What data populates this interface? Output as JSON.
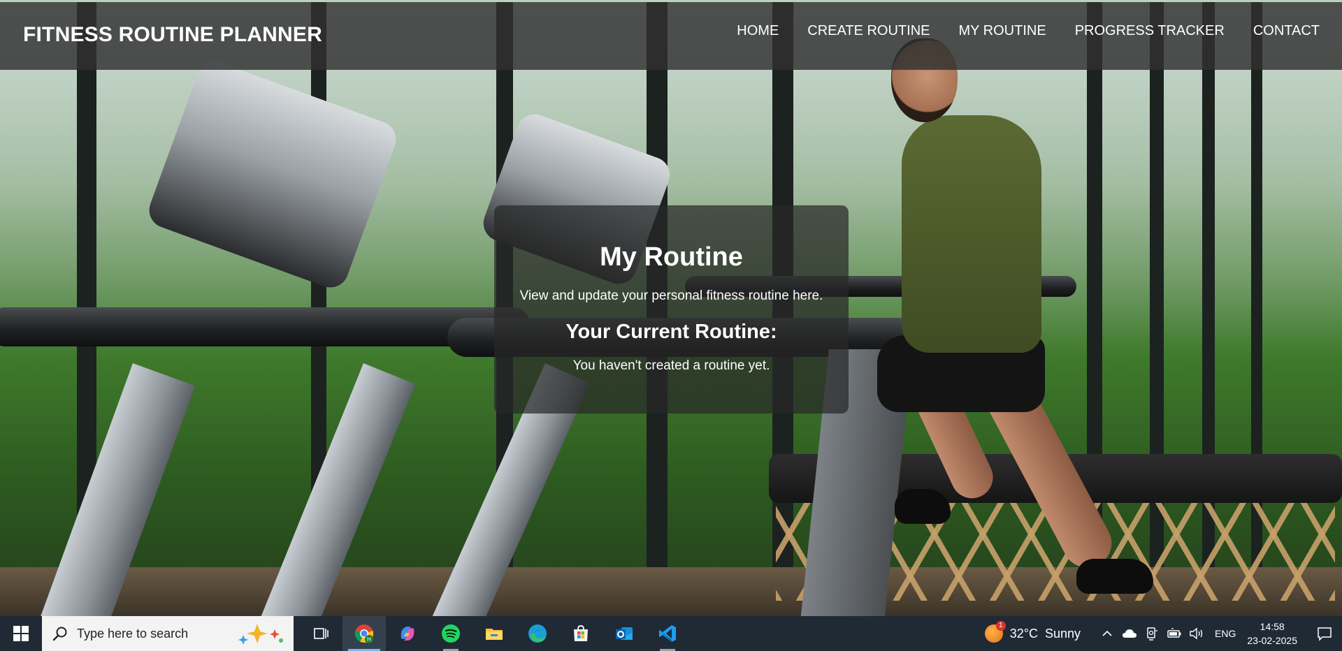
{
  "app": {
    "brand": "FITNESS ROUTINE PLANNER"
  },
  "nav": {
    "items": [
      {
        "label": "HOME"
      },
      {
        "label": "CREATE ROUTINE"
      },
      {
        "label": "MY ROUTINE"
      },
      {
        "label": "PROGRESS TRACKER"
      },
      {
        "label": "CONTACT"
      }
    ]
  },
  "hero": {
    "background_icon": "gym-treadmill-runner-photo",
    "title": "My Routine",
    "description": "View and update your personal fitness routine here.",
    "subtitle": "Your Current Routine:",
    "empty_message": "You haven't created a routine yet."
  },
  "taskbar": {
    "search_placeholder": "Type here to search",
    "apps": [
      {
        "icon": "task-view-icon",
        "active": false
      },
      {
        "icon": "chrome-icon",
        "active": true
      },
      {
        "icon": "copilot-icon",
        "active": false
      },
      {
        "icon": "spotify-icon",
        "active": false
      },
      {
        "icon": "file-explorer-icon",
        "active": false
      },
      {
        "icon": "edge-icon",
        "active": false
      },
      {
        "icon": "microsoft-store-icon",
        "active": false
      },
      {
        "icon": "outlook-icon",
        "active": false
      },
      {
        "icon": "vscode-icon",
        "active": false
      }
    ],
    "weather": {
      "temperature": "32°C",
      "condition": "Sunny",
      "badge": "1"
    },
    "language": "ENG",
    "time": "14:58",
    "date": "23-02-2025"
  },
  "colors": {
    "navbar_bg": "#303030",
    "card_bg": "#282828",
    "taskbar_bg": "#1f2a35",
    "accent_underline": "#79b8e8"
  }
}
